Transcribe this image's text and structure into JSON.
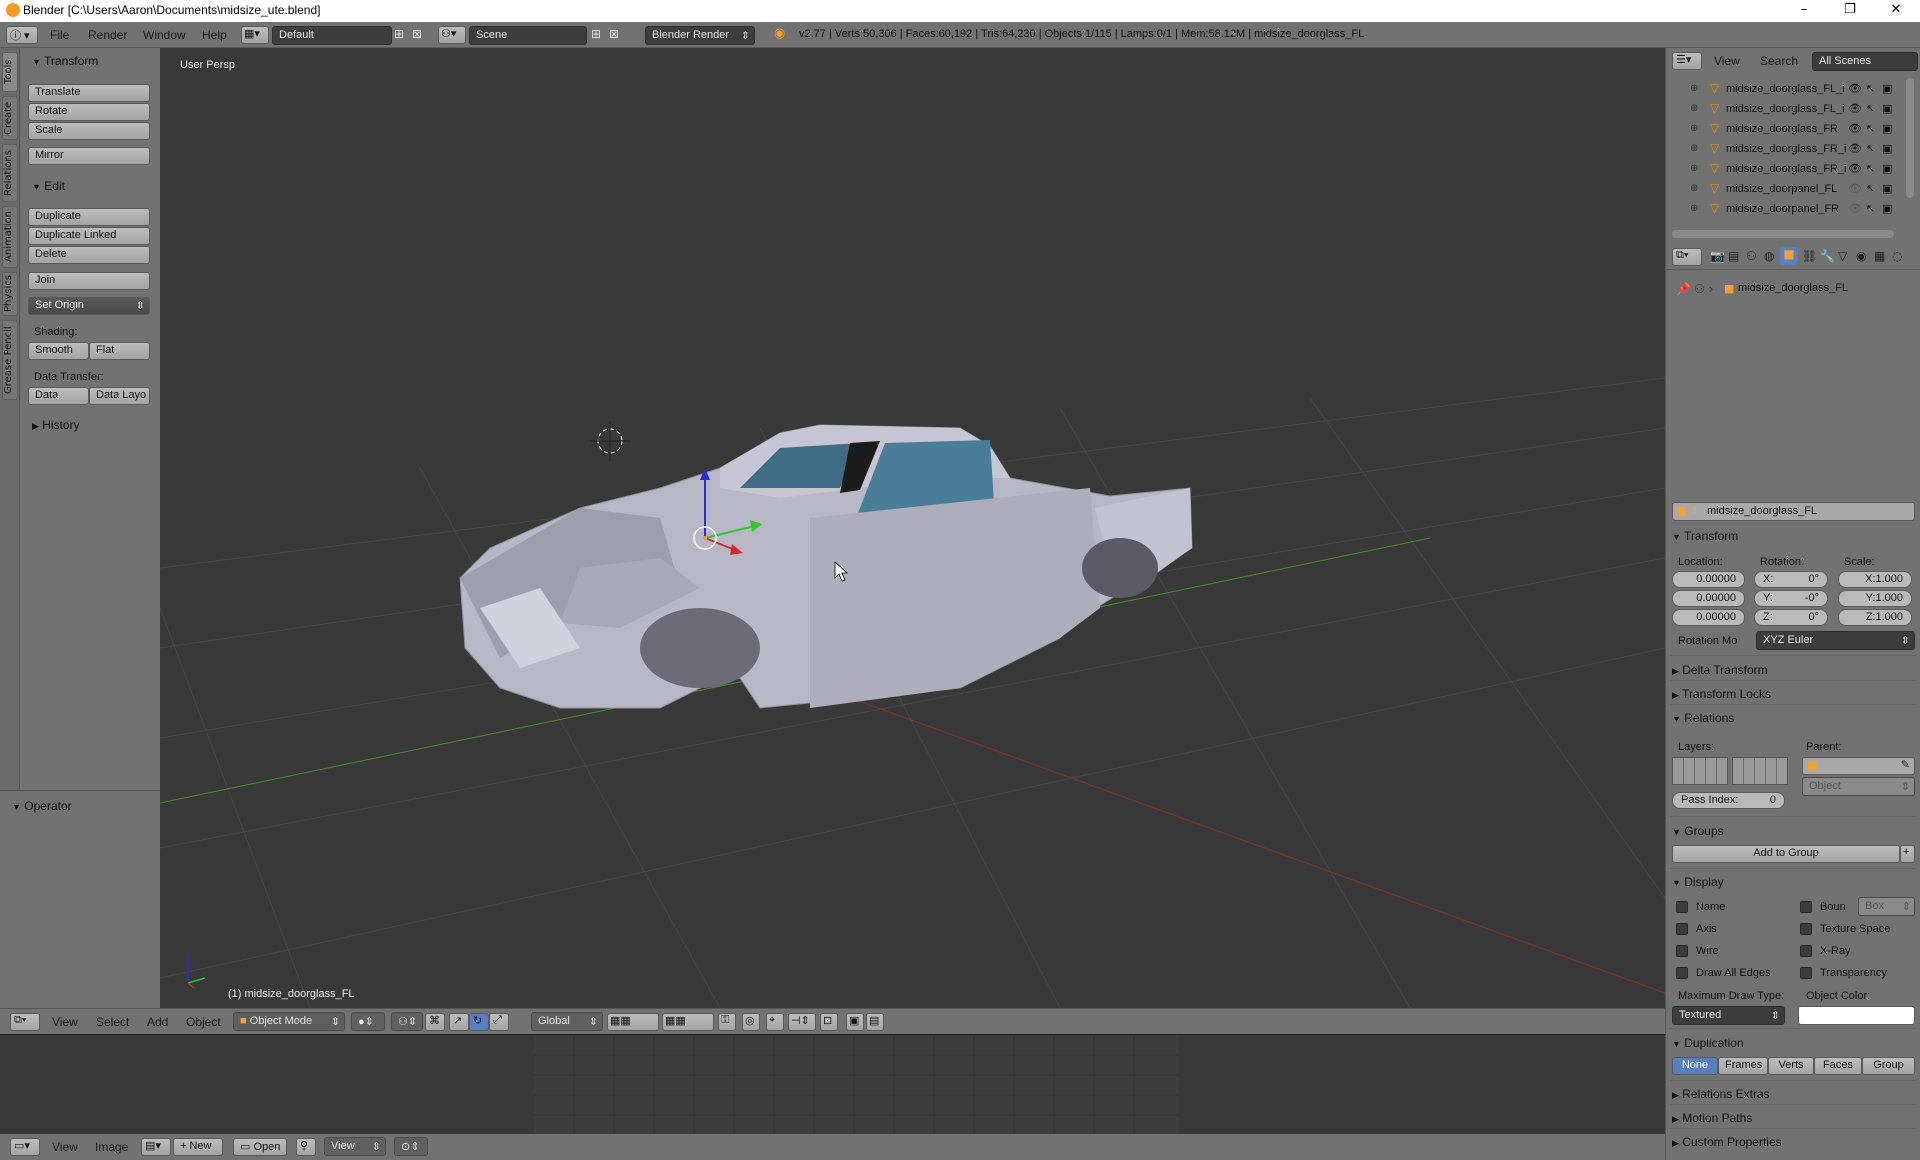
{
  "window": {
    "title": "Blender [C:\\Users\\Aaron\\Documents\\midsize_ute.blend]",
    "controls": [
      "–",
      "❐",
      "✕"
    ]
  },
  "infobar": {
    "menus": [
      "File",
      "Render",
      "Window",
      "Help"
    ],
    "layout": "Default",
    "scene": "Scene",
    "engine": "Blender Render",
    "stats": "v2.77 | Verts:50,306 | Faces:60,192 | Tris:64,230 | Objects:1/115 | Lamps:0/1 | Mem:58.12M | midsize_doorglass_FL"
  },
  "toolstrip": {
    "tabs": [
      "Tools",
      "Create",
      "Relations",
      "Animation",
      "Physics",
      "Grease Pencil"
    ]
  },
  "toolshelf": {
    "transform_header": "Transform",
    "transform_buttons": [
      "Translate",
      "Rotate",
      "Scale"
    ],
    "mirror": "Mirror",
    "edit_header": "Edit",
    "edit_buttons": [
      "Duplicate",
      "Duplicate Linked",
      "Delete"
    ],
    "join": "Join",
    "set_origin": "Set Origin",
    "shading_label": "Shading:",
    "smooth": "Smooth",
    "flat": "Flat",
    "data_transfer_label": "Data Transfer:",
    "data": "Data",
    "data_layout": "Data Layo",
    "history": "History"
  },
  "operator": {
    "header": "Operator"
  },
  "viewport": {
    "view_name": "User Persp",
    "object_label": "(1) midsize_doorglass_FL"
  },
  "viewport_header": {
    "menus": [
      "View",
      "Select",
      "Add",
      "Object"
    ],
    "mode": "Object Mode",
    "orientation": "Global"
  },
  "uv_header": {
    "menus": [
      "View",
      "Image"
    ],
    "new": "New",
    "open": "Open",
    "view": "View"
  },
  "outliner": {
    "header_menus": [
      "View",
      "Search"
    ],
    "display": "All Scenes",
    "items": [
      {
        "name": "midsize_doorglass_FL_i"
      },
      {
        "name": "midsize_doorglass_FL_i"
      },
      {
        "name": "midsize_doorglass_FR"
      },
      {
        "name": "midsize_doorglass_FR_i"
      },
      {
        "name": "midsize_doorglass_FR_i"
      },
      {
        "name": "midsize_doorpanel_FL"
      },
      {
        "name": "midsize_doorpanel_FR"
      }
    ]
  },
  "properties": {
    "breadcrumb": "midsize_doorglass_FL",
    "object_name": "midsize_doorglass_FL",
    "transform": {
      "header": "Transform",
      "location_label": "Location:",
      "rotation_label": "Rotation:",
      "scale_label": "Scale:",
      "location": [
        "0.00000",
        "0.00000",
        "0.00000"
      ],
      "rotation": [
        {
          "axis": "X:",
          "value": "0°"
        },
        {
          "axis": "Y:",
          "value": "-0°"
        },
        {
          "axis": "Z:",
          "value": "0°"
        }
      ],
      "scale": [
        "X:1.000",
        "Y:1.000",
        "Z:1.000"
      ],
      "rotation_mode_label": "Rotation Mo",
      "rotation_mode": "XYZ Euler"
    },
    "delta_transform": "Delta Transform",
    "transform_locks": "Transform Locks",
    "relations": {
      "header": "Relations",
      "layers_label": "Layers:",
      "parent_label": "Parent:",
      "parent_type": "Object",
      "pass_index_label": "Pass Index:",
      "pass_index": "0"
    },
    "groups": {
      "header": "Groups",
      "add": "Add to Group"
    },
    "display": {
      "header": "Display",
      "left": [
        "Name",
        "Axis",
        "Wire",
        "Draw All Edges"
      ],
      "right": [
        "Boun",
        "Texture Space",
        "X-Ray",
        "Transparency"
      ],
      "bounds_type": "Box",
      "max_draw_label": "Maximum Draw Type:",
      "max_draw": "Textured",
      "object_color_label": "Object Color:"
    },
    "duplication": {
      "header": "Duplication",
      "options": [
        "None",
        "Frames",
        "Verts",
        "Faces",
        "Group"
      ],
      "selected": "None"
    },
    "relations_extras": "Relations Extras",
    "motion_paths": "Motion Paths",
    "custom_properties": "Custom Properties"
  }
}
